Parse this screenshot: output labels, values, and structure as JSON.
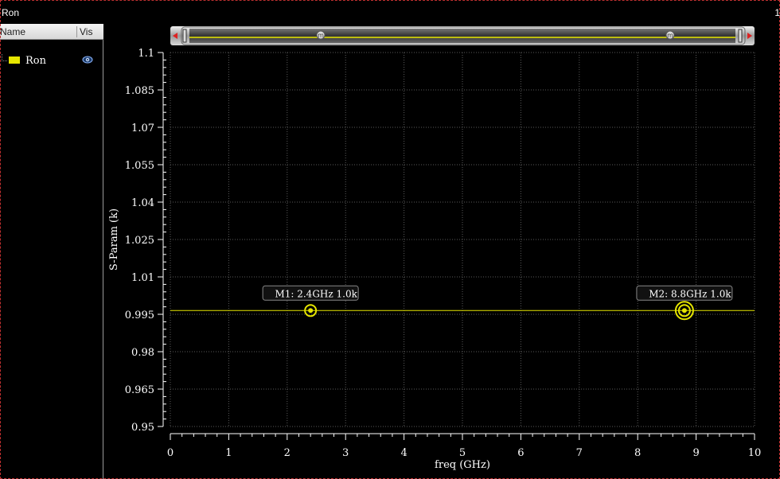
{
  "window": {
    "title": "Ron",
    "right_label": "1"
  },
  "legend": {
    "header_name": "Name",
    "header_vis": "Vis",
    "items": [
      {
        "label": "Ron",
        "color": "#e6e600",
        "visible_icon": "eye-icon"
      }
    ]
  },
  "slider": {
    "handle_glyph": "m"
  },
  "chart_data": {
    "type": "line",
    "xlabel": "freq (GHz)",
    "ylabel": "S-Param (k)",
    "xlim": [
      0,
      10
    ],
    "ylim": [
      0.95,
      1.1
    ],
    "x_ticks": [
      "0",
      "1",
      "2",
      "3",
      "4",
      "5",
      "6",
      "7",
      "8",
      "9",
      "10"
    ],
    "y_ticks": [
      "1.1",
      "1.085",
      "1.07",
      "1.055",
      "1.04",
      "1.025",
      "1.01",
      "0.995",
      "0.98",
      "0.965",
      "0.95"
    ],
    "grid": true,
    "series": [
      {
        "name": "Ron",
        "color": "#e6e600",
        "x": [
          0,
          10
        ],
        "y": [
          0.9965,
          0.9965
        ]
      }
    ],
    "markers": [
      {
        "label": "M1: 2.4GHz 1.0k",
        "x": 2.4,
        "y": 0.9965
      },
      {
        "label": "M2: 8.8GHz 1.0k",
        "x": 8.8,
        "y": 0.9965
      }
    ]
  }
}
